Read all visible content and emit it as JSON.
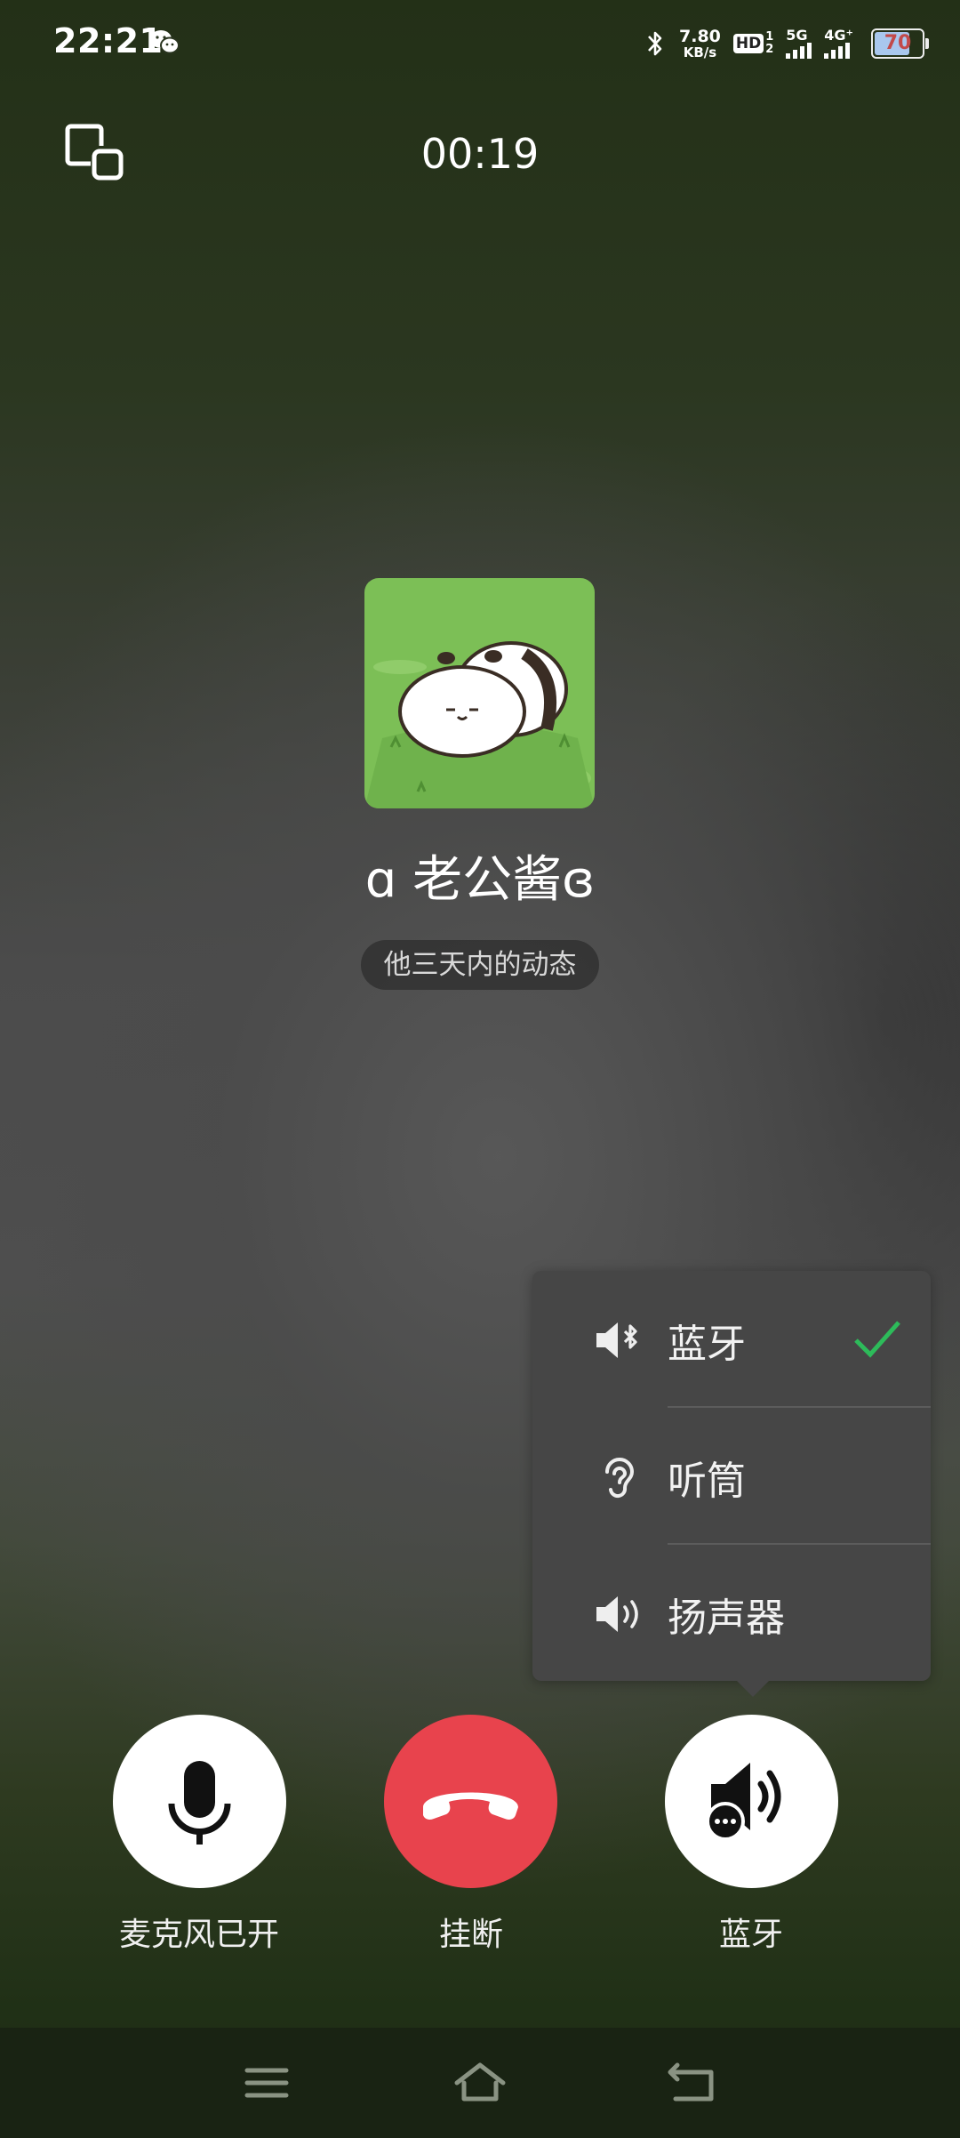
{
  "status_bar": {
    "time": "22:21",
    "net_speed_value": "7.80",
    "net_speed_unit": "KB/s",
    "hd_label": "HD",
    "hd_sim_top": "1",
    "hd_sim_bottom": "2",
    "net1_label": "5G",
    "net2_label": "4G⁺",
    "battery_level": "70",
    "icons": [
      "wechat-icon",
      "bluetooth-icon",
      "signal-icon",
      "battery-icon"
    ]
  },
  "call": {
    "timer": "00:19",
    "contact_name": "ɑ 老公酱ɞ",
    "moments_label": "他三天内的动态"
  },
  "audio_menu": {
    "items": [
      {
        "label": "蓝牙",
        "icon": "speaker-bluetooth-icon",
        "selected": true
      },
      {
        "label": "听筒",
        "icon": "ear-icon",
        "selected": false
      },
      {
        "label": "扬声器",
        "icon": "speaker-icon",
        "selected": false
      }
    ],
    "check_color": "#2dbb5a"
  },
  "controls": {
    "mic_label": "麦克风已开",
    "hangup_label": "挂断",
    "audio_label": "蓝牙",
    "hangup_color": "#e8434d"
  },
  "nav": {
    "icons": [
      "menu-icon",
      "home-icon",
      "back-icon"
    ]
  }
}
